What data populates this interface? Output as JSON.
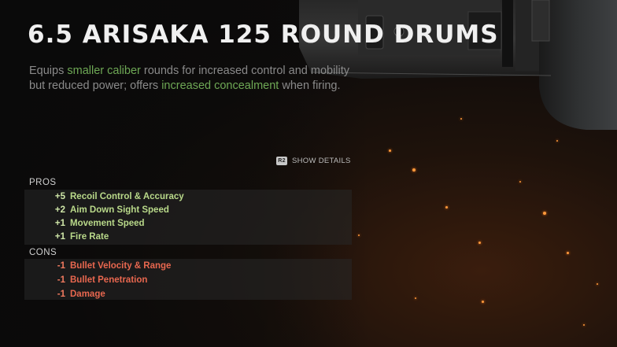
{
  "title": "6.5 ARISAKA 125 ROUND DRUMS",
  "description": {
    "part1": "Equips ",
    "hl1": "smaller caliber",
    "part2": " rounds for increased control and mobility but reduced power; offers ",
    "hl2": "increased concealment",
    "part3": " when firing."
  },
  "show_details": {
    "key": "R2",
    "label": "SHOW DETAILS"
  },
  "pros": {
    "label": "PROS",
    "items": [
      {
        "value": "+5",
        "label": "Recoil Control & Accuracy"
      },
      {
        "value": "+2",
        "label": "Aim Down Sight Speed"
      },
      {
        "value": "+1",
        "label": "Movement Speed"
      },
      {
        "value": "+1",
        "label": "Fire Rate"
      }
    ]
  },
  "cons": {
    "label": "CONS",
    "items": [
      {
        "value": "-1",
        "label": "Bullet Velocity & Range"
      },
      {
        "value": "-1",
        "label": "Bullet Penetration"
      },
      {
        "value": "-1",
        "label": "Damage"
      }
    ]
  },
  "colors": {
    "highlight": "#6ea855",
    "pro": "#b9d98a",
    "con": "#e8674f"
  }
}
